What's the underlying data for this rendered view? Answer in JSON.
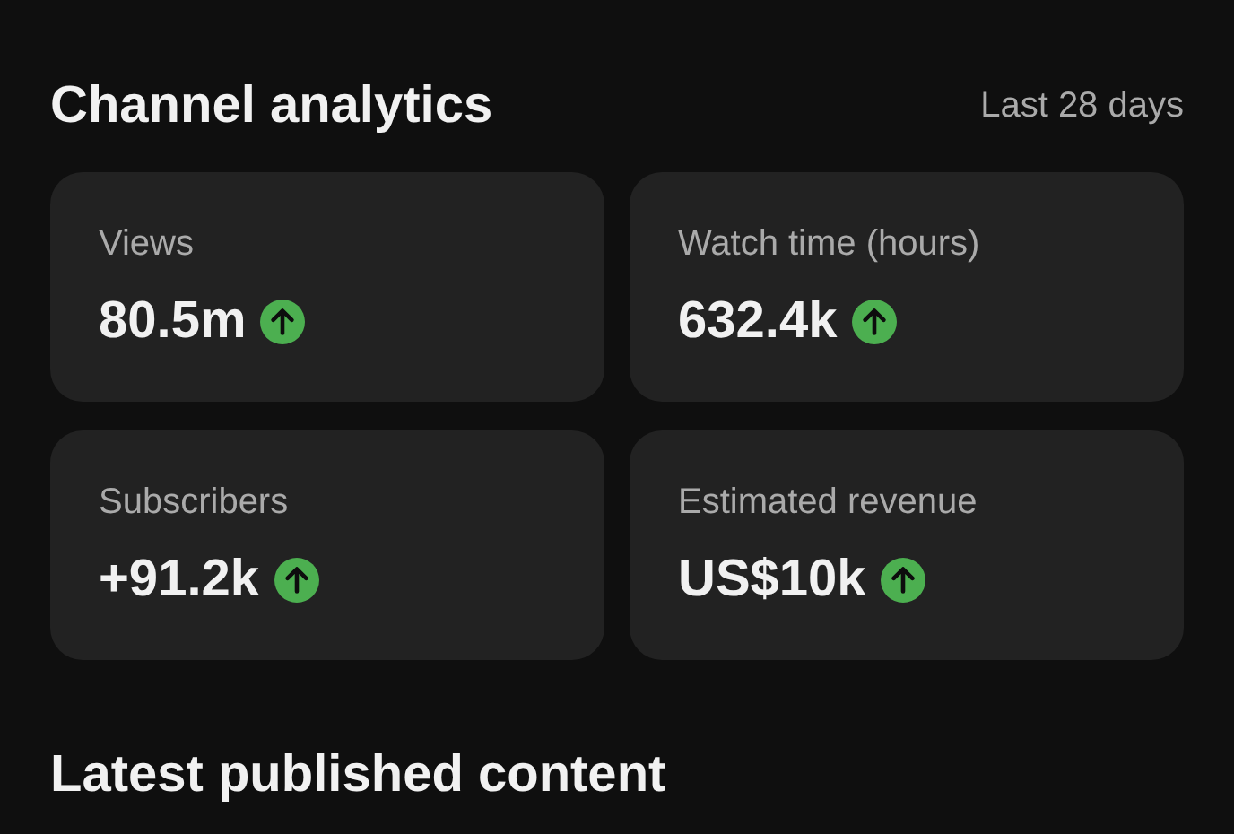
{
  "header": {
    "title": "Channel analytics",
    "period": "Last 28 days"
  },
  "metrics": [
    {
      "label": "Views",
      "value": "80.5m",
      "rising": true
    },
    {
      "label": "Watch time (hours)",
      "value": "632.4k",
      "rising": true
    },
    {
      "label": "Subscribers",
      "value": "+91.2k",
      "rising": true
    },
    {
      "label": "Estimated revenue",
      "value": "US$10k",
      "rising": true
    }
  ],
  "section": {
    "title": "Latest published content"
  }
}
